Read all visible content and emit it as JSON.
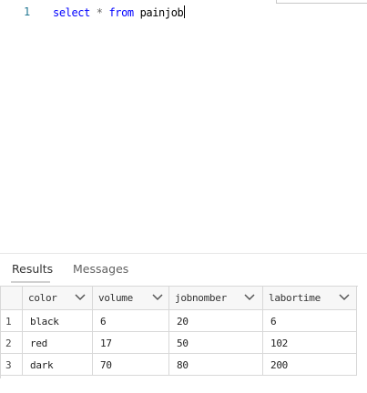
{
  "editor": {
    "line_number": "1",
    "tokens": {
      "select": "select",
      "star": "*",
      "from": "from",
      "table": "painjob"
    }
  },
  "tabs": [
    {
      "label": "Results",
      "active": true
    },
    {
      "label": "Messages",
      "active": false
    }
  ],
  "grid": {
    "columns": [
      "color",
      "volume",
      "jobnomber",
      "labortime"
    ],
    "rows": [
      {
        "num": "1",
        "cells": [
          "black",
          "6",
          "20",
          "6"
        ]
      },
      {
        "num": "2",
        "cells": [
          "red",
          "17",
          "50",
          "102"
        ]
      },
      {
        "num": "3",
        "cells": [
          "dark",
          "70",
          "80",
          "200"
        ]
      }
    ]
  },
  "colors": {
    "keyword": "#0000ff",
    "line_number": "#237893",
    "grid_border": "#d8d8d8"
  },
  "icons": {
    "column_sort": "chevron-down-icon"
  }
}
